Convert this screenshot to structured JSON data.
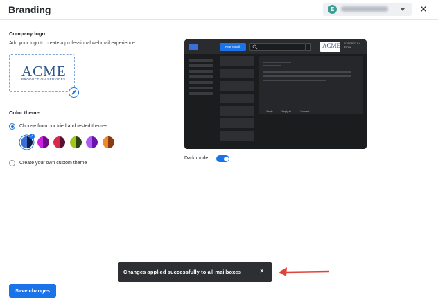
{
  "header": {
    "title": "Branding",
    "account_initial": "E"
  },
  "logo_section": {
    "label": "Company logo",
    "hint": "Add your logo to create a professional webmail experience",
    "logo_text": "ACME",
    "logo_subtext": "PRODUCTION SERVICES"
  },
  "color_theme": {
    "label": "Color theme",
    "option_preset": "Choose from our tried and tested themes",
    "option_custom": "Create your own custom theme",
    "selected_option": "preset",
    "swatches": [
      {
        "left": "#3a6fd8",
        "right": "#0f1d4a",
        "selected": true
      },
      {
        "left": "#d01ee0",
        "right": "#6e0a88",
        "selected": false
      },
      {
        "left": "#d8284e",
        "right": "#5a0f2a",
        "selected": false
      },
      {
        "left": "#a6c41e",
        "right": "#2e4410",
        "selected": false
      },
      {
        "left": "#b05bf0",
        "right": "#6a14b0",
        "selected": false
      },
      {
        "left": "#f08a22",
        "right": "#8a3c10",
        "selected": false
      }
    ]
  },
  "preview": {
    "new_email": "New email",
    "logo_text": "ACME",
    "powered_by": "POWERED BY",
    "brand": "TITAN",
    "actions": [
      "Reply",
      "Reply all",
      "Forward"
    ]
  },
  "dark_mode": {
    "label": "Dark mode",
    "enabled": true
  },
  "toast": {
    "message": "Changes applied successfully to all mailboxes",
    "close": "✕"
  },
  "footer": {
    "save_label": "Save changes"
  },
  "colors": {
    "accent": "#1a73e8",
    "toast_bg": "#2e2f32"
  }
}
